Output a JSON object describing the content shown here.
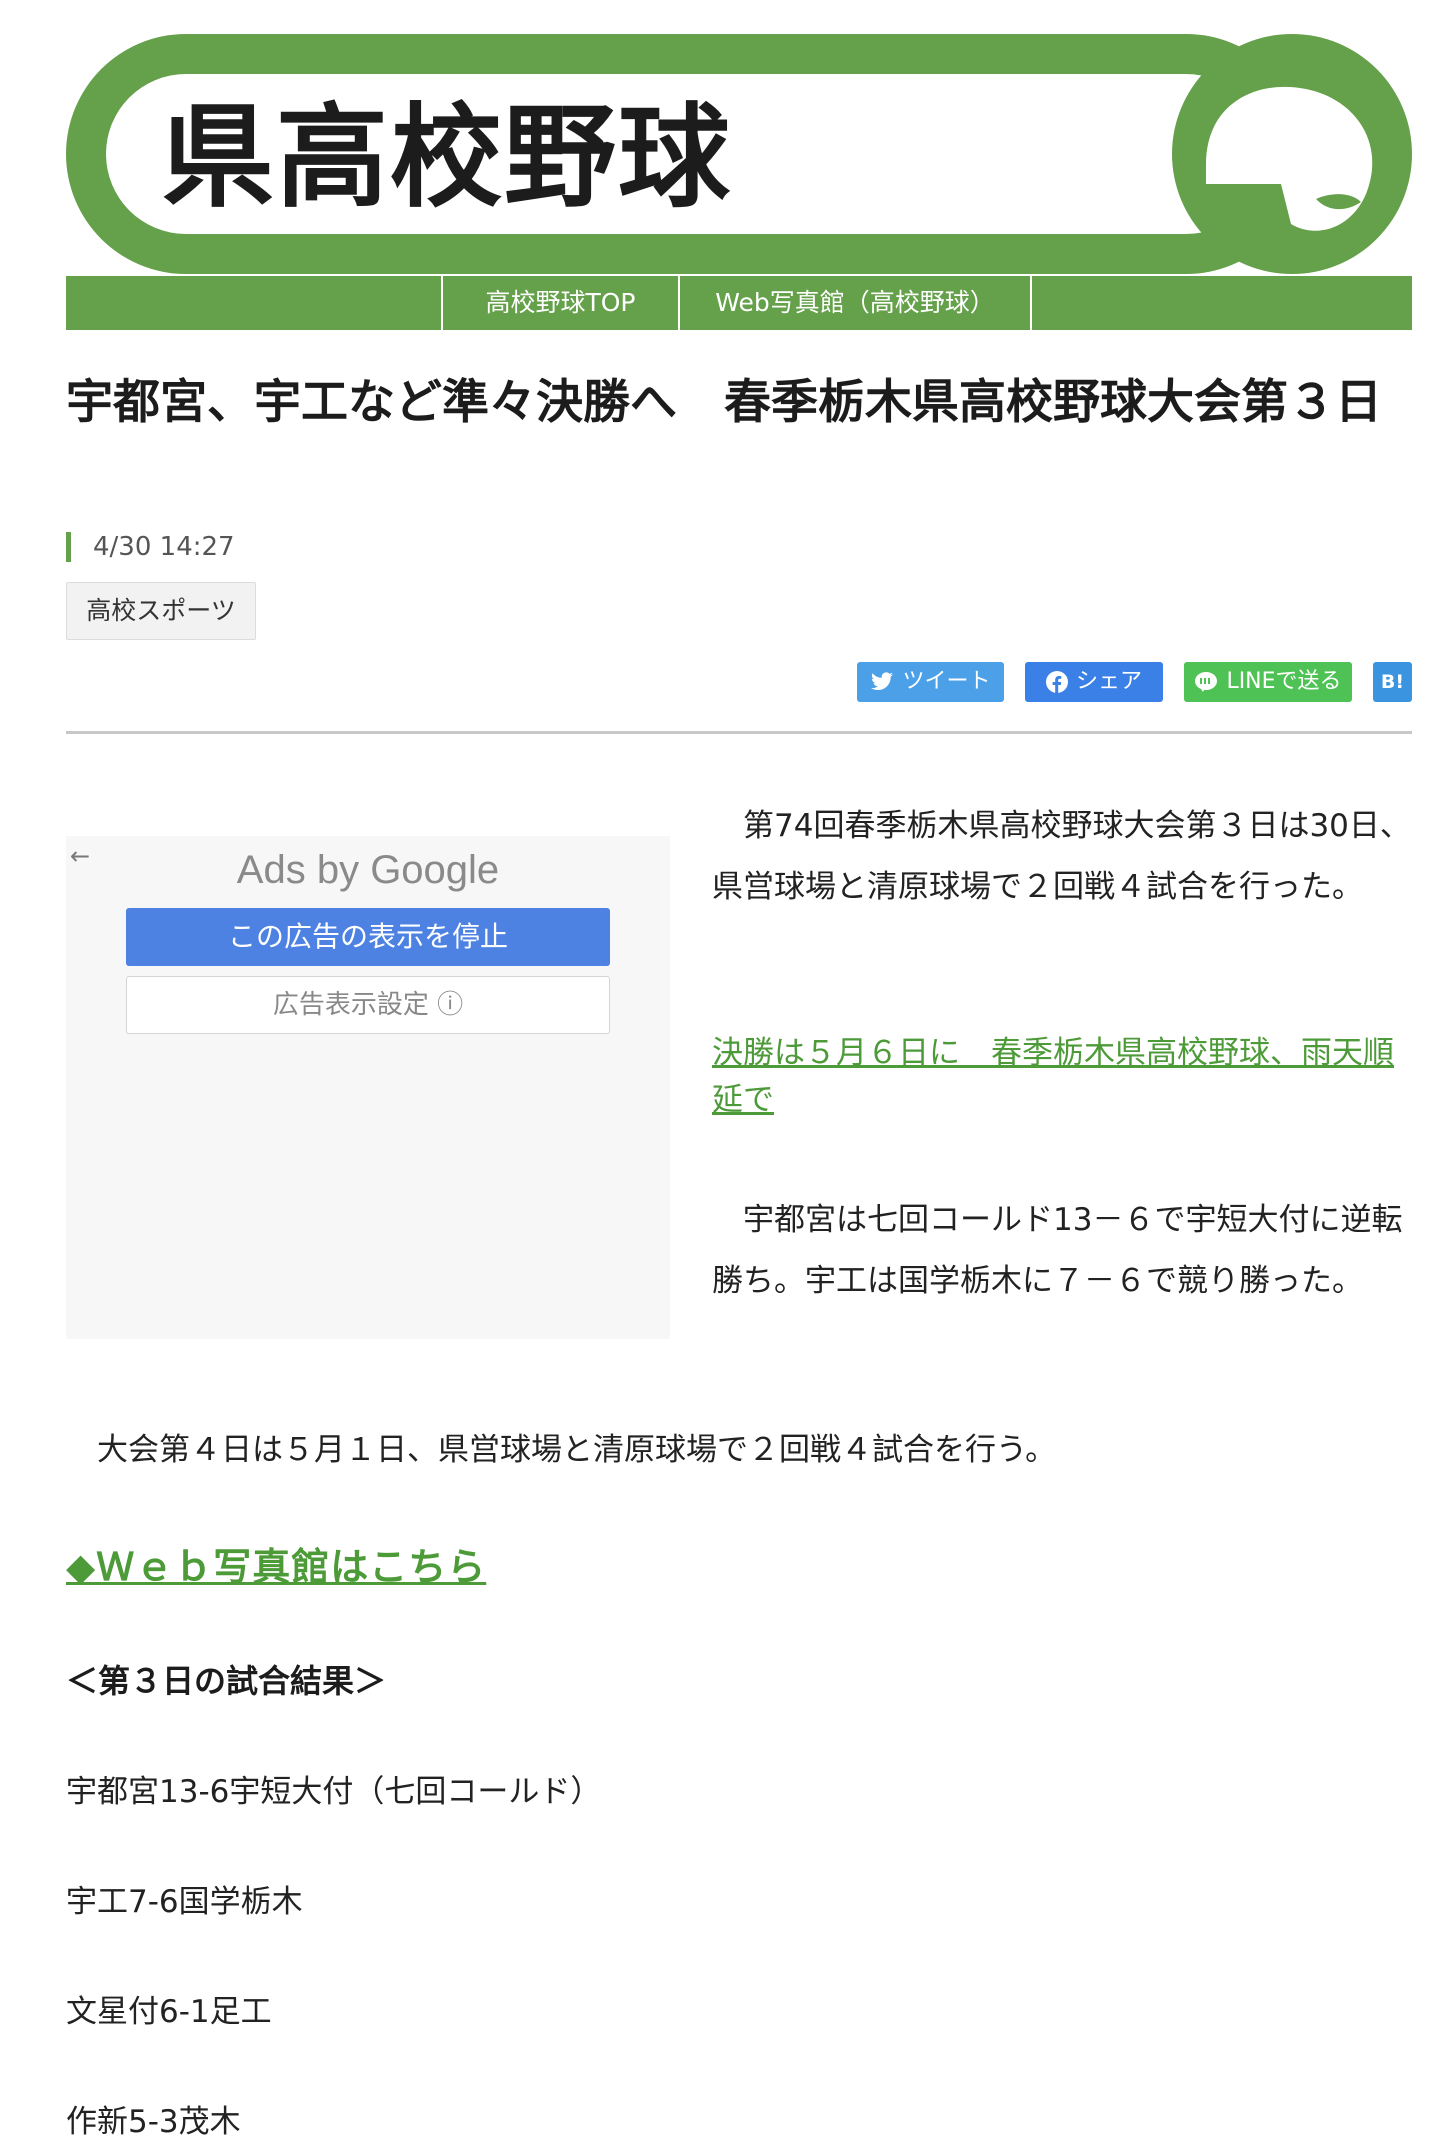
{
  "banner": {
    "title": "県高校野球"
  },
  "nav": {
    "items": [
      {
        "label": "高校野球TOP"
      },
      {
        "label": "Web写真館（高校野球）"
      }
    ]
  },
  "article": {
    "title": "宇都宮、宇工など準々決勝へ　春季栃木県高校野球大会第３日",
    "time": "4/30 14:27",
    "category": "高校スポーツ",
    "para1": "　第74回春季栃木県高校野球大会第３日は30日、県営球場と清原球場で２回戦４試合を行った。",
    "link1": "決勝は５月６日に　春季栃木県高校野球、雨天順延で",
    "para2": "　宇都宮は七回コールド13－６で宇短大付に逆転勝ち。宇工は国学栃木に７－６で競り勝った。",
    "para3": "　大会第４日は５月１日、県営球場と清原球場で２回戦４試合を行う。",
    "link2": "◆Ｗｅｂ写真館はこちら",
    "results_title": "＜第３日の試合結果＞",
    "results": [
      "宇都宮13-6宇短大付（七回コールド）",
      "宇工7-6国学栃木",
      "文星付6-1足工",
      "作新5-3茂木"
    ]
  },
  "share": {
    "tweet": "ツイート",
    "facebook": "シェア",
    "line": "LINEで送る",
    "hatena": "B!"
  },
  "ad": {
    "back": "←",
    "ads_by": "Ads by Google",
    "stop": "この広告の表示を停止",
    "settings": "広告表示設定 ⓘ"
  },
  "colors": {
    "brand_green": "#65a04a",
    "link_green": "#4c9a38"
  }
}
